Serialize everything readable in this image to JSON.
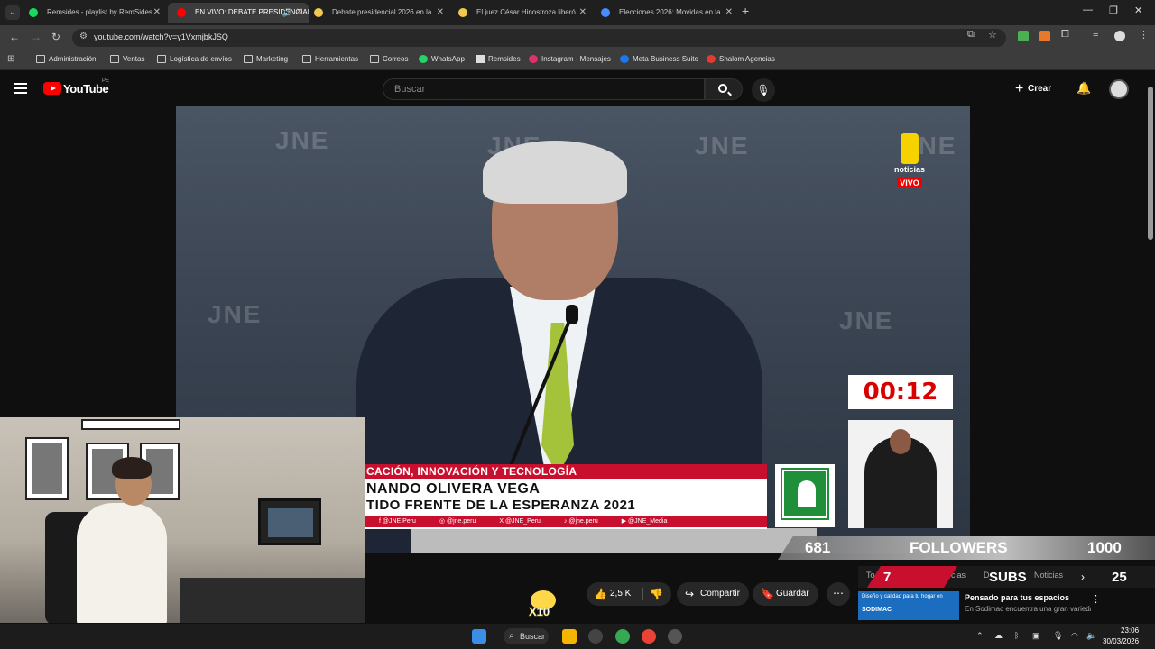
{
  "browser": {
    "tabs": [
      {
        "title": "Remsides - playlist by RemSides",
        "favicon_color": "#1ed760",
        "active": false
      },
      {
        "title": "EN VIVO: DEBATE PRESIDENCIAL",
        "favicon_color": "#ff0000",
        "active": true
      },
      {
        "title": "Debate presidencial 2026 en la",
        "favicon_color": "#f2c94c",
        "active": false
      },
      {
        "title": "El juez César Hinostroza liberó",
        "favicon_color": "#f2c94c",
        "active": false
      },
      {
        "title": "Elecciones 2026: Movidas en la",
        "favicon_color": "#4a8cff",
        "active": false
      }
    ],
    "url": "youtube.com/watch?v=y1VxmjbkJSQ",
    "bookmarks": [
      {
        "label": "Administración",
        "icon": "folder-icon"
      },
      {
        "label": "Ventas",
        "icon": "folder-icon"
      },
      {
        "label": "Logística de envíos",
        "icon": "folder-icon"
      },
      {
        "label": "Marketing",
        "icon": "folder-icon"
      },
      {
        "label": "Herramientas",
        "icon": "folder-icon"
      },
      {
        "label": "Correos",
        "icon": "folder-icon"
      },
      {
        "label": "WhatsApp",
        "icon": "whatsapp-icon"
      },
      {
        "label": "Remsides",
        "icon": "remsides-icon"
      },
      {
        "label": "Instagram - Mensajes",
        "icon": "instagram-icon"
      },
      {
        "label": "Meta Business Suite",
        "icon": "meta-icon"
      },
      {
        "label": "Shalom Agencias",
        "icon": "shalom-icon"
      }
    ]
  },
  "youtube": {
    "logo_text": "YouTube",
    "country_code": "PE",
    "search_placeholder": "Buscar",
    "create_label": "Crear"
  },
  "video": {
    "watermark": "JNE",
    "channel_name": "noticias",
    "live_badge": "VIVO",
    "timer": "00:12",
    "lower_third": {
      "topic": "CACIÓN, INNOVACIÓN Y TECNOLOGÍA",
      "name": "NANDO OLIVERA VEGA",
      "party": "TIDO FRENTE DE LA ESPERANZA 2021",
      "socials": [
        "f @JNE.Peru",
        "◎ @jne.peru",
        "X @JNE_Peru",
        "♪ @jne.peru",
        "▶ @JNE_Media"
      ]
    }
  },
  "overlays": {
    "followers_count": "681",
    "followers_label": "FOLLOWERS",
    "followers_goal": "1000",
    "subs_count": "7",
    "subs_label": "SUBS",
    "subs_goal": "25",
    "chip_1": "To",
    "chip_2": "cias",
    "chip_3": "D",
    "chip_4": "Noticias",
    "mascot_text": "X10"
  },
  "actions": {
    "likes": "2,5 K",
    "share_label": "Compartir",
    "save_label": "Guardar"
  },
  "ad": {
    "thumb_text": "Diseño y calidad para tu hogar en",
    "brand": "SODIMAC",
    "title": "Pensado para tus espacios",
    "description": "En Sodimac encuentra una gran variedad en Muebles, ahora en miles"
  },
  "taskbar": {
    "search_label": "Buscar",
    "time": "23:06",
    "date": "30/03/2026"
  }
}
